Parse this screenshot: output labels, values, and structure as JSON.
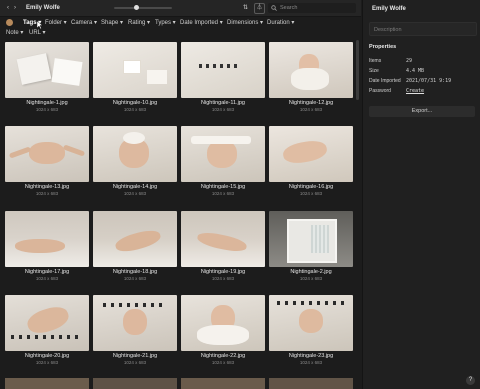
{
  "window": {
    "title": "Emily Wolfe"
  },
  "toolbar": {
    "back": "‹",
    "forward": "›",
    "search_placeholder": "Search",
    "sort_glyph": "⇅",
    "filter_glyph": "⏃"
  },
  "filters": [
    {
      "label": "Tags",
      "active": true
    },
    {
      "label": "Folder"
    },
    {
      "label": "Camera"
    },
    {
      "label": "Shape"
    },
    {
      "label": "Rating"
    },
    {
      "label": "Types"
    },
    {
      "label": "Date Imported"
    },
    {
      "label": "Dimensions"
    },
    {
      "label": "Duration"
    },
    {
      "label": "Note"
    },
    {
      "label": "URL"
    }
  ],
  "files": [
    {
      "name": "Nightingale-1.jpg",
      "size": "1024 x 683"
    },
    {
      "name": "Nightingale-10.jpg",
      "size": "1024 x 683"
    },
    {
      "name": "Nightingale-11.jpg",
      "size": "1024 x 683"
    },
    {
      "name": "Nightingale-12.jpg",
      "size": "1024 x 683"
    },
    {
      "name": "Nightingale-13.jpg",
      "size": "1024 x 683"
    },
    {
      "name": "Nightingale-14.jpg",
      "size": "1024 x 683"
    },
    {
      "name": "Nightingale-15.jpg",
      "size": "1024 x 683"
    },
    {
      "name": "Nightingale-16.jpg",
      "size": "1024 x 683"
    },
    {
      "name": "Nightingale-17.jpg",
      "size": "1024 x 683"
    },
    {
      "name": "Nightingale-18.jpg",
      "size": "1024 x 683"
    },
    {
      "name": "Nightingale-19.jpg",
      "size": "1024 x 683"
    },
    {
      "name": "Nightingale-2.jpg",
      "size": "1024 x 683"
    },
    {
      "name": "Nightingale-20.jpg",
      "size": "1024 x 683"
    },
    {
      "name": "Nightingale-21.jpg",
      "size": "1024 x 683"
    },
    {
      "name": "Nightingale-22.jpg",
      "size": "1024 x 683"
    },
    {
      "name": "Nightingale-23.jpg",
      "size": "1024 x 683"
    }
  ],
  "panel": {
    "title": "Emily Wolfe",
    "description_placeholder": "Description",
    "section_title": "Properties",
    "props": [
      {
        "key": "Items",
        "value": "29"
      },
      {
        "key": "Size",
        "value": "4.4 MB"
      },
      {
        "key": "Date Imported",
        "value": "2021/07/31 9:19"
      },
      {
        "key": "Password",
        "value": "Create"
      }
    ],
    "export_label": "Export..."
  },
  "help_label": "?"
}
